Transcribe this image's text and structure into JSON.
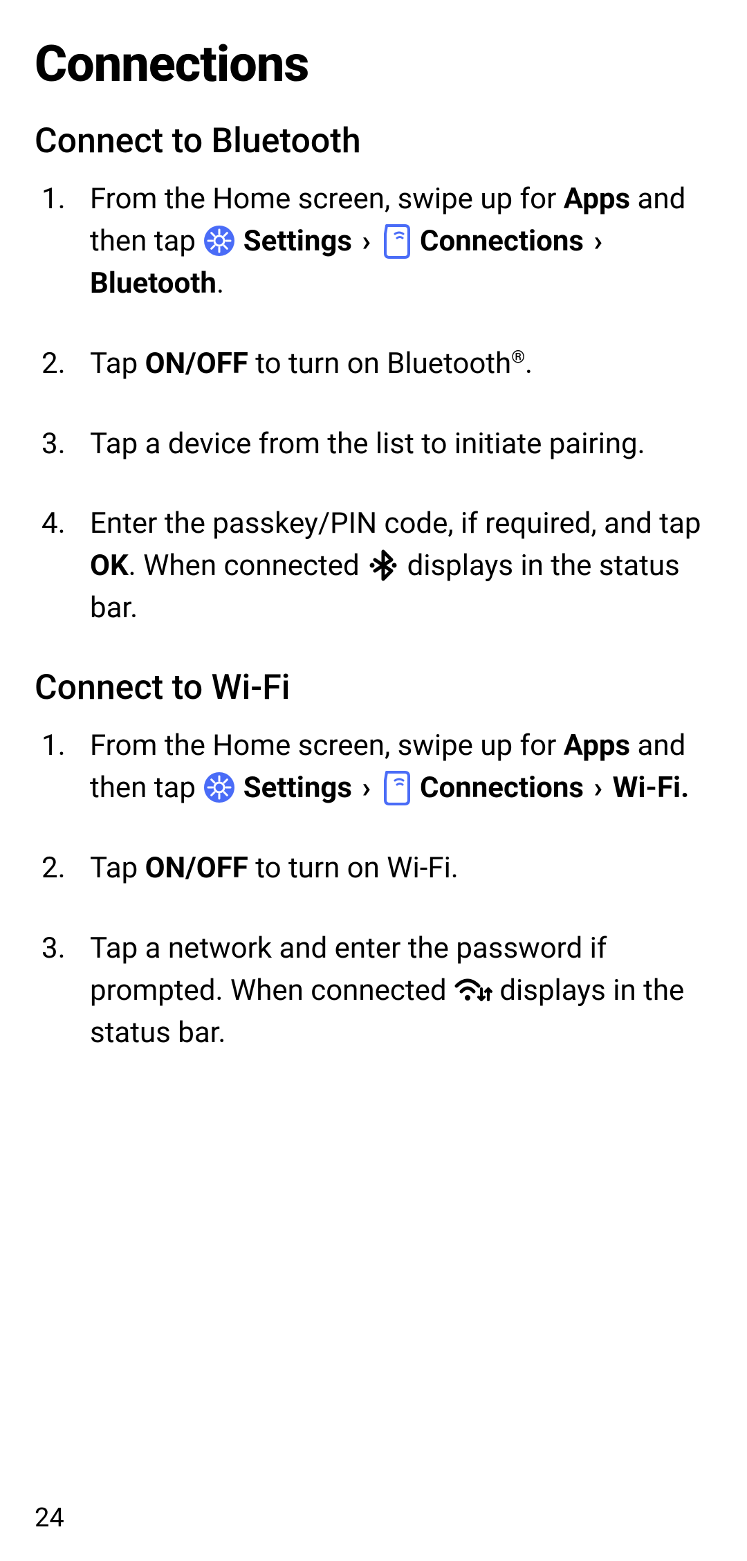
{
  "title": "Connections",
  "section_bt": {
    "heading": "Connect to Bluetooth",
    "steps": {
      "s1": {
        "pre": "From the Home screen, swipe up for ",
        "apps": "Apps",
        "mid": " and then tap ",
        "settings": "Settings",
        "chev1": " › ",
        "connections": "Connections",
        "chev2": " › ",
        "target": "Bluetooth",
        "end": "."
      },
      "s2": {
        "pre": "Tap ",
        "onoff": "ON/OFF",
        "mid": " to turn on Bluetooth",
        "reg": "®",
        "end": "."
      },
      "s3": "Tap a device from the list to initiate pairing.",
      "s4": {
        "pre": "Enter the passkey/PIN code, if required, and tap ",
        "ok": "OK",
        "mid": ". When connected ",
        "end": " displays in the status bar."
      }
    }
  },
  "section_wifi": {
    "heading": "Connect to Wi-Fi",
    "steps": {
      "s1": {
        "pre": "From the Home screen, swipe up for ",
        "apps": "Apps",
        "mid": " and then tap ",
        "settings": "Settings",
        "chev1": " › ",
        "connections": "Connections",
        "chev2": " › ",
        "target": "Wi-Fi.",
        "end": ""
      },
      "s2": {
        "pre": "Tap ",
        "onoff": "ON/OFF",
        "end": " to turn on Wi-Fi."
      },
      "s3": {
        "pre": "Tap a network and enter the password if prompted. When connected ",
        "end": " displays in the status bar."
      }
    }
  },
  "page_number": "24",
  "icons": {
    "settings_color": "#4a6cf7",
    "connections_color": "#4a6cf7"
  }
}
